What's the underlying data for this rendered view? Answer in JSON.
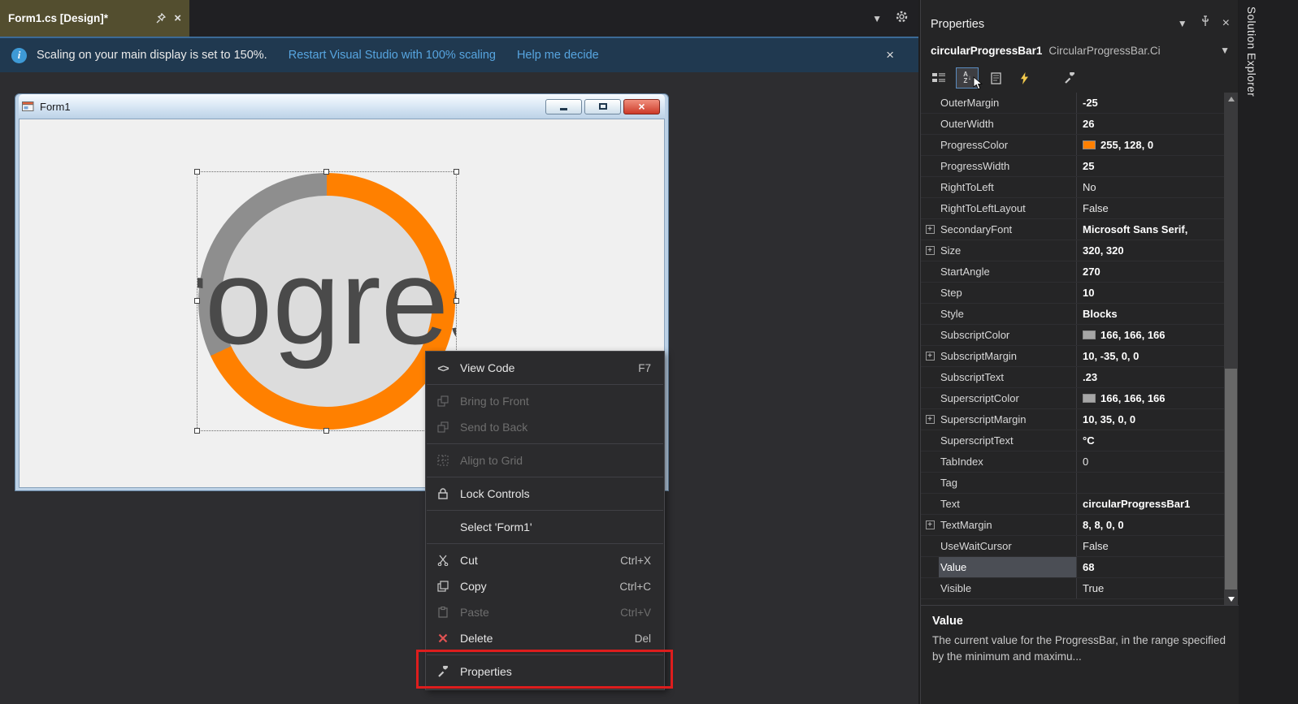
{
  "colors": {
    "active_tab_gold": "#534e2f",
    "info_link_blue": "#57a5e0",
    "progress_orange": "#ff8000",
    "progress_remainder_gray": "#8e8e8e",
    "swatch_gray": "#a6a6a6",
    "annotation_red": "#dd1d1d",
    "close_button_red": "#cd3a28"
  },
  "editor": {
    "tab_title": "Form1.cs [Design]*",
    "info_bar": {
      "message": "Scaling on your main display is set to 150%.",
      "restart_link": "Restart Visual Studio with 100% scaling",
      "help_link": "Help me decide"
    },
    "form": {
      "title": "Form1",
      "progress_text": "Progress"
    }
  },
  "context_menu": {
    "items": [
      {
        "label": "View Code",
        "shortcut": "F7"
      },
      {
        "label": "Bring to Front",
        "shortcut": ""
      },
      {
        "label": "Send to Back",
        "shortcut": ""
      },
      {
        "label": "Align to Grid",
        "shortcut": ""
      },
      {
        "label": "Lock Controls",
        "shortcut": ""
      },
      {
        "label": "Select 'Form1'",
        "shortcut": ""
      },
      {
        "label": "Cut",
        "shortcut": "Ctrl+X"
      },
      {
        "label": "Copy",
        "shortcut": "Ctrl+C"
      },
      {
        "label": "Paste",
        "shortcut": "Ctrl+V"
      },
      {
        "label": "Delete",
        "shortcut": "Del"
      },
      {
        "label": "Properties",
        "shortcut": ""
      }
    ]
  },
  "properties_panel": {
    "title": "Properties",
    "object_name": "circularProgressBar1",
    "object_type": "CircularProgressBar.Ci",
    "rows": [
      {
        "name": "OuterMargin",
        "value": "-25"
      },
      {
        "name": "OuterWidth",
        "value": "26"
      },
      {
        "name": "ProgressColor",
        "value": "255, 128, 0"
      },
      {
        "name": "ProgressWidth",
        "value": "25"
      },
      {
        "name": "RightToLeft",
        "value": "No"
      },
      {
        "name": "RightToLeftLayout",
        "value": "False"
      },
      {
        "name": "SecondaryFont",
        "value": "Microsoft Sans Serif,"
      },
      {
        "name": "Size",
        "value": "320, 320"
      },
      {
        "name": "StartAngle",
        "value": "270"
      },
      {
        "name": "Step",
        "value": "10"
      },
      {
        "name": "Style",
        "value": "Blocks"
      },
      {
        "name": "SubscriptColor",
        "value": "166, 166, 166"
      },
      {
        "name": "SubscriptMargin",
        "value": "10, -35, 0, 0"
      },
      {
        "name": "SubscriptText",
        "value": ".23"
      },
      {
        "name": "SuperscriptColor",
        "value": "166, 166, 166"
      },
      {
        "name": "SuperscriptMargin",
        "value": "10, 35, 0, 0"
      },
      {
        "name": "SuperscriptText",
        "value": "°C"
      },
      {
        "name": "TabIndex",
        "value": "0"
      },
      {
        "name": "Tag",
        "value": ""
      },
      {
        "name": "Text",
        "value": "circularProgressBar1"
      },
      {
        "name": "TextMargin",
        "value": "8, 8, 0, 0"
      },
      {
        "name": "UseWaitCursor",
        "value": "False"
      },
      {
        "name": "Value",
        "value": "68"
      },
      {
        "name": "Visible",
        "value": "True"
      }
    ],
    "description": {
      "title": "Value",
      "text": "The current value for the ProgressBar, in the range specified by the minimum and maximu..."
    }
  },
  "right_strip": {
    "tab_label": "Solution Explorer"
  }
}
